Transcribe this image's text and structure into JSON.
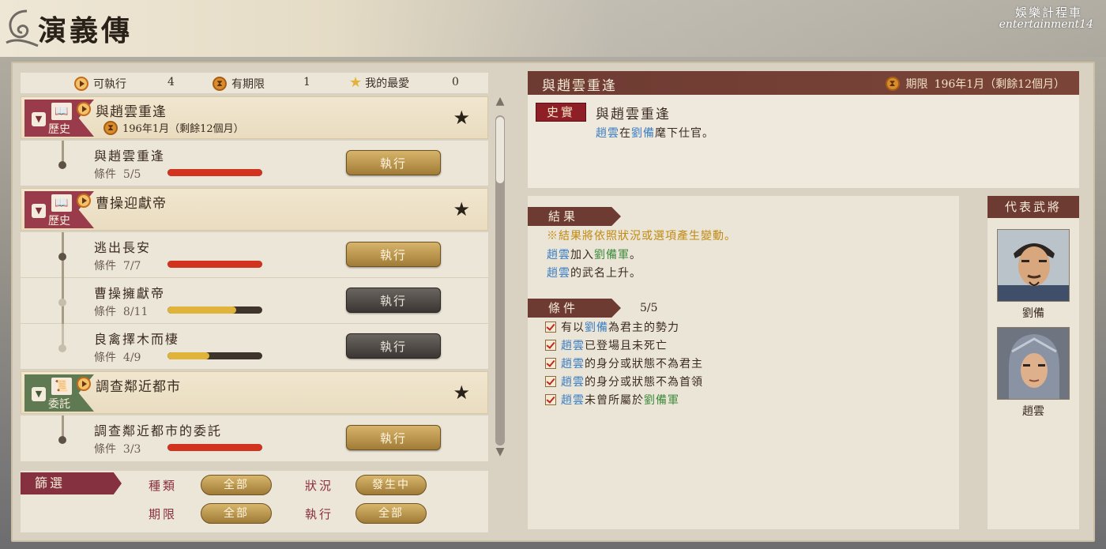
{
  "header": {
    "title": "演義傳",
    "watermark_cn": "娛樂計程車",
    "watermark_en": "entertainment14"
  },
  "summary": {
    "executable_label": "可執行",
    "executable_count": "4",
    "limited_label": "有期限",
    "limited_count": "1",
    "favorite_label": "我的最愛",
    "favorite_count": "0"
  },
  "missions": [
    {
      "category": "歷史",
      "title": "與趙雲重逢",
      "deadline": "196年1月（剩餘12個月）",
      "steps": [
        {
          "title": "與趙雲重逢",
          "cond_label": "條件",
          "cond": "5/5",
          "progress": 1.0,
          "button": "執行"
        }
      ]
    },
    {
      "category": "歷史",
      "title": "曹操迎獻帝",
      "steps": [
        {
          "title": "逃出長安",
          "cond_label": "條件",
          "cond": "7/7",
          "progress": 1.0,
          "button": "執行"
        },
        {
          "title": "曹操擁獻帝",
          "cond_label": "條件",
          "cond": "8/11",
          "progress": 0.727,
          "button": "執行"
        },
        {
          "title": "良禽擇木而棲",
          "cond_label": "條件",
          "cond": "4/9",
          "progress": 0.444,
          "button": "執行"
        }
      ]
    },
    {
      "category": "委託",
      "title": "調查鄰近都市",
      "steps": [
        {
          "title": "調查鄰近都市的委託",
          "cond_label": "條件",
          "cond": "3/3",
          "progress": 1.0,
          "button": "執行"
        }
      ]
    }
  ],
  "filter": {
    "title": "篩選",
    "type_label": "種類",
    "type_value": "全部",
    "status_label": "狀況",
    "status_value": "發生中",
    "deadline_label": "期限",
    "deadline_value": "全部",
    "exec_label": "執行",
    "exec_value": "全部"
  },
  "detail": {
    "title": "與趙雲重逢",
    "deadline_label": "期限",
    "deadline_value": "196年1月（剩餘12個月）",
    "fact_badge": "史實",
    "fact_title": "與趙雲重逢",
    "fact_desc_name1": "趙雲",
    "fact_desc_mid": "在",
    "fact_desc_name2": "劉備",
    "fact_desc_end": "麾下仕官。",
    "result_label": "結果",
    "result_warning": "※結果將依照狀況或選項產生變動。",
    "result_1_name": "趙雲",
    "result_1_mid": "加入",
    "result_1_force": "劉備軍",
    "result_1_end": "。",
    "result_2_name": "趙雲",
    "result_2_end": "的武名上升。",
    "cond_label": "條件",
    "cond_count": "5/5",
    "conditions": [
      {
        "pre": "有以",
        "name": "劉備",
        "post": "為君主的勢力"
      },
      {
        "pre": "",
        "name": "趙雲",
        "post": "已登場且未死亡"
      },
      {
        "pre": "",
        "name": "趙雲",
        "post": "的身分或狀態不為君主"
      },
      {
        "pre": "",
        "name": "趙雲",
        "post": "的身分或狀態不為首領"
      },
      {
        "pre": "",
        "name": "趙雲",
        "post": "未曾所屬於",
        "force": "劉備軍"
      }
    ]
  },
  "officers": {
    "title": "代表武將",
    "list": [
      {
        "name": "劉備"
      },
      {
        "name": "趙雲"
      }
    ]
  },
  "colors": {
    "history_badge": "#9a3b4b",
    "commission_badge": "#5f7a52",
    "progress_full": "#d2331f",
    "progress_partial": "#e0b43a",
    "header_brown": "#6e3b32"
  }
}
